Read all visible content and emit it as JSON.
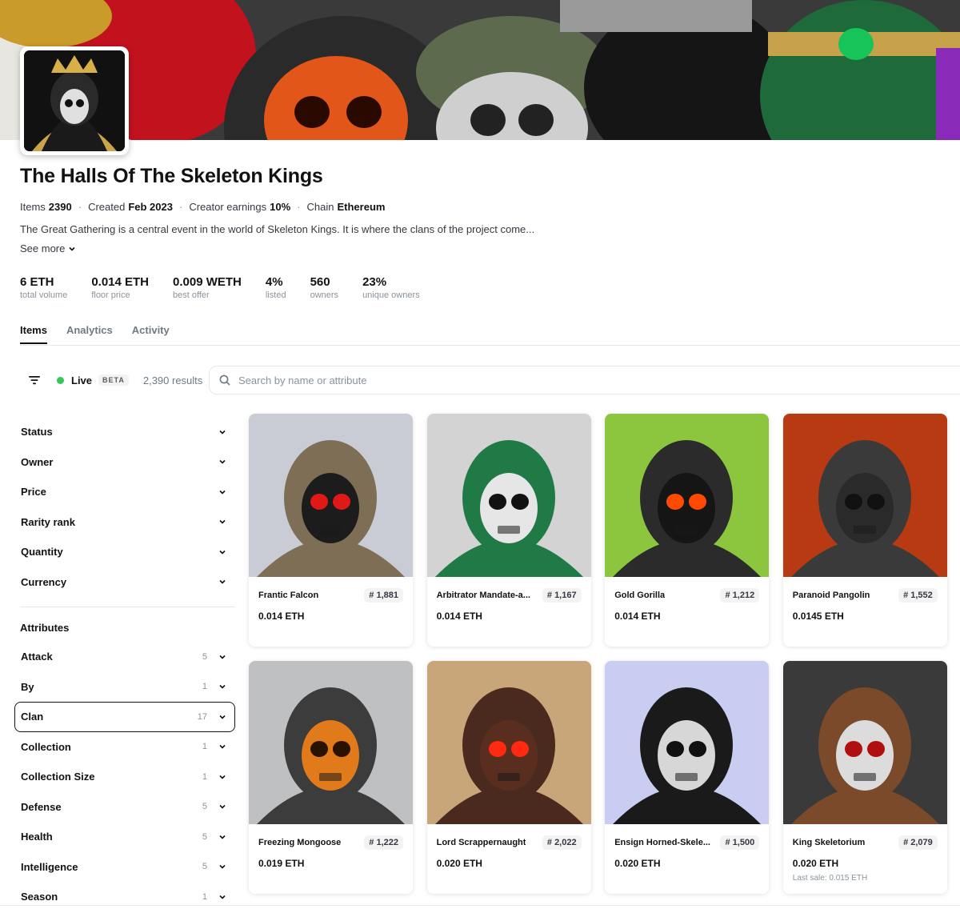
{
  "collection": {
    "title": "The Halls Of The Skeleton Kings",
    "meta": [
      {
        "label": "Items",
        "value": "2390"
      },
      {
        "label": "Created",
        "value": "Feb 2023"
      },
      {
        "label": "Creator earnings",
        "value": "10%"
      },
      {
        "label": "Chain",
        "value": "Ethereum"
      }
    ],
    "description": "The Great Gathering is a central event in the world of Skeleton Kings. It is where the clans of the project come...",
    "see_more": "See more"
  },
  "stats": [
    {
      "value": "6 ETH",
      "label": "total volume"
    },
    {
      "value": "0.014 ETH",
      "label": "floor price"
    },
    {
      "value": "0.009 WETH",
      "label": "best offer"
    },
    {
      "value": "4%",
      "label": "listed"
    },
    {
      "value": "560",
      "label": "owners"
    },
    {
      "value": "23%",
      "label": "unique owners"
    }
  ],
  "tabs": [
    "Items",
    "Analytics",
    "Activity"
  ],
  "toolbar": {
    "live": "Live",
    "beta": "BETA",
    "results": "2,390 results",
    "search_placeholder": "Search by name or attribute"
  },
  "filters": [
    "Status",
    "Owner",
    "Price",
    "Rarity rank",
    "Quantity",
    "Currency"
  ],
  "attributes_heading": "Attributes",
  "attributes": [
    {
      "name": "Attack",
      "count": "5"
    },
    {
      "name": "By",
      "count": "1"
    },
    {
      "name": "Clan",
      "count": "17"
    },
    {
      "name": "Collection",
      "count": "1"
    },
    {
      "name": "Collection Size",
      "count": "1"
    },
    {
      "name": "Defense",
      "count": "5"
    },
    {
      "name": "Health",
      "count": "5"
    },
    {
      "name": "Intelligence",
      "count": "5"
    },
    {
      "name": "Season",
      "count": "1"
    }
  ],
  "items": [
    {
      "name": "Frantic Falcon",
      "rank": "# 1,881",
      "price": "0.014 ETH",
      "last_sale": "",
      "bg": "#c9ccd4",
      "hood": "#7d6e55",
      "skull": "#1c1c1c",
      "eye": "#e01818"
    },
    {
      "name": "Arbitrator Mandate-a...",
      "rank": "# 1,167",
      "price": "0.014 ETH",
      "last_sale": "",
      "bg": "#d3d3d3",
      "hood": "#1f7a45",
      "skull": "#e6e6e6",
      "eye": "#111111"
    },
    {
      "name": "Gold Gorilla",
      "rank": "# 1,212",
      "price": "0.014 ETH",
      "last_sale": "",
      "bg": "#8cc63f",
      "hood": "#2b2b2b",
      "skull": "#151515",
      "eye": "#ff4a00"
    },
    {
      "name": "Paranoid Pangolin",
      "rank": "# 1,552",
      "price": "0.0145 ETH",
      "last_sale": "",
      "bg": "#b83a12",
      "hood": "#3a3a3a",
      "skull": "#2a2a2a",
      "eye": "#111111"
    },
    {
      "name": "Freezing Mongoose",
      "rank": "# 1,222",
      "price": "0.019 ETH",
      "last_sale": "",
      "bg": "#bfc0c2",
      "hood": "#3c3c3c",
      "skull": "#e07a1a",
      "eye": "#2a1200"
    },
    {
      "name": "Lord Scrappernaught",
      "rank": "# 2,022",
      "price": "0.020 ETH",
      "last_sale": "",
      "bg": "#c9a57a",
      "hood": "#4a2a1e",
      "skull": "#5a2e1e",
      "eye": "#ff2a10"
    },
    {
      "name": "Ensign Horned-Skele...",
      "rank": "# 1,500",
      "price": "0.020 ETH",
      "last_sale": "",
      "bg": "#c9cdf2",
      "hood": "#1a1a1a",
      "skull": "#d7d7d7",
      "eye": "#111111"
    },
    {
      "name": "King Skeletorium",
      "rank": "# 2,079",
      "price": "0.020 ETH",
      "last_sale": "Last sale: 0.015 ETH",
      "bg": "#3a3a3a",
      "hood": "#7a4a2a",
      "skull": "#dcdcdc",
      "eye": "#b01010"
    }
  ]
}
